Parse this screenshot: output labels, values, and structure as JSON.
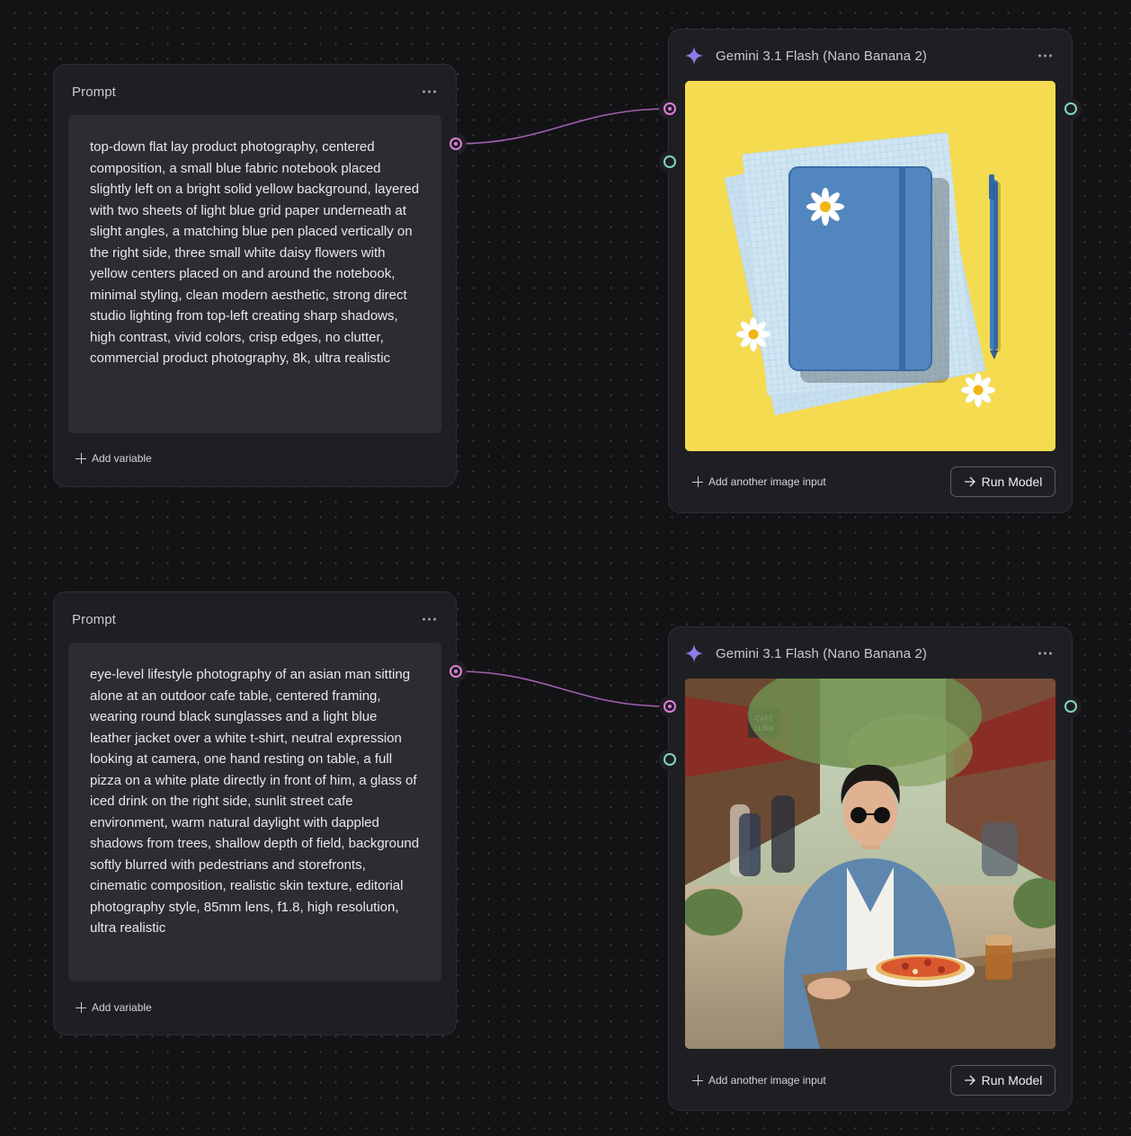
{
  "prompt_nodes": [
    {
      "title": "Prompt",
      "text": "top-down flat lay product photography, centered composition, a small blue fabric notebook placed slightly left on a bright solid yellow background, layered with two sheets of light blue grid paper underneath at slight angles, a matching blue pen placed vertically on the right side, three small white daisy flowers with yellow centers placed on and around the notebook, minimal styling, clean modern aesthetic, strong direct studio lighting from top-left creating sharp shadows, high contrast, vivid colors, crisp edges, no clutter, commercial product photography, 8k, ultra realistic",
      "add_variable": "Add variable"
    },
    {
      "title": "Prompt",
      "text": "eye-level lifestyle photography of an asian man sitting alone at an outdoor cafe table, centered framing, wearing round black sunglasses and a light blue leather jacket over a white t-shirt, neutral expression looking at camera, one hand resting on table, a full pizza on a white plate directly in front of him, a glass of iced drink on the right side, sunlit street cafe environment, warm natural daylight with dappled shadows from trees, shallow depth of field, background softly blurred with pedestrians and storefronts, cinematic composition, realistic skin texture, editorial photography style, 85mm lens, f1.8, high resolution, ultra realistic",
      "add_variable": "Add variable"
    }
  ],
  "model_nodes": [
    {
      "title": "Gemini 3.1 Flash (Nano Banana 2)",
      "add_image_input": "Add another image input",
      "run_label": "Run Model",
      "image_kind": "notebook-flatlay"
    },
    {
      "title": "Gemini 3.1 Flash (Nano Banana 2)",
      "add_image_input": "Add another image input",
      "run_label": "Run Model",
      "image_kind": "cafe-portrait",
      "sign_text": "CAFE LUNA"
    }
  ],
  "colors": {
    "canvas_bg": "#131316",
    "node_bg": "#1f1f23",
    "text_port": "#e07ed9",
    "image_port": "#7fd8b8",
    "wire": "#a061b0",
    "sparkle": "#8f7ae8"
  }
}
